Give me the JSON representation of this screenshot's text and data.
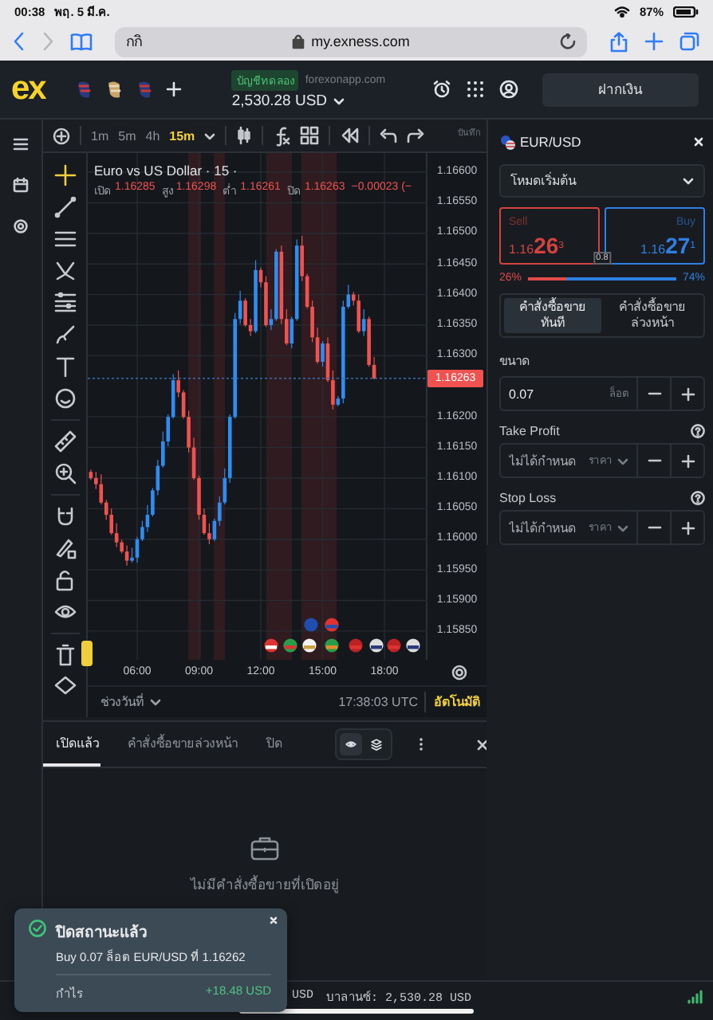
{
  "status_bar": {
    "time": "00:38",
    "date": "พฤ. 5 มี.ค.",
    "battery": "87%"
  },
  "browser": {
    "tab_hint": "กกิ",
    "url": "my.exness.com"
  },
  "header": {
    "logo": "ex",
    "account_badge": "บัญชีทดลอง",
    "account_server": "forexonapp.com",
    "balance": "2,530.28 USD",
    "deposit_button": "ฝากเงิน"
  },
  "toolbar": {
    "timeframes": [
      {
        "label": "1m",
        "selected": false
      },
      {
        "label": "5m",
        "selected": false
      },
      {
        "label": "4h",
        "selected": false
      },
      {
        "label": "15m",
        "selected": true
      }
    ],
    "save_label": "บันทึก"
  },
  "chart": {
    "title": "Euro vs US Dollar · 15 ·",
    "ohlc": [
      {
        "label": "เปิด",
        "value": "1.16285"
      },
      {
        "label": "สูง",
        "value": "1.16298"
      },
      {
        "label": "ต่ำ",
        "value": "1.16261"
      },
      {
        "label": "ปิด",
        "value": "1.16263"
      }
    ],
    "change": "−0.00023 (−",
    "chart_data": {
      "type": "candlestick",
      "x": [
        3.75,
        4,
        4.25,
        4.5,
        4.75,
        5,
        5.25,
        5.5,
        5.75,
        6,
        6.25,
        6.5,
        6.75,
        7,
        7.25,
        7.5,
        7.75,
        8,
        8.25,
        8.5,
        8.75,
        9,
        9.25,
        9.5,
        9.75,
        10,
        10.25,
        10.5,
        10.75,
        11,
        11.25,
        11.5,
        11.75,
        12,
        12.25,
        12.5,
        12.75,
        13,
        13.25,
        13.5,
        13.75,
        14,
        14.25,
        14.5,
        14.75,
        15,
        15.25,
        15.5,
        15.75,
        16,
        16.25,
        16.5,
        16.75,
        17,
        17.25,
        17.5
      ],
      "ohlc": [
        [
          1.1611,
          1.16114,
          1.16097,
          1.161
        ],
        [
          1.161,
          1.1611,
          1.16082,
          1.1609
        ],
        [
          1.1609,
          1.16106,
          1.16057,
          1.1606
        ],
        [
          1.1606,
          1.16064,
          1.16032,
          1.1604
        ],
        [
          1.1604,
          1.1605,
          1.16007,
          1.1601
        ],
        [
          1.1601,
          1.16026,
          1.15987,
          1.15995
        ],
        [
          1.15995,
          1.15999,
          1.15977,
          1.1598
        ],
        [
          1.1598,
          1.1599,
          1.15957,
          1.15965
        ],
        [
          1.15965,
          1.15986,
          1.15962,
          1.1597
        ],
        [
          1.1597,
          1.16004,
          1.15962,
          1.16
        ],
        [
          1.16,
          1.1603,
          1.15997,
          1.1602
        ],
        [
          1.1602,
          1.16056,
          1.16012,
          1.1604
        ],
        [
          1.1604,
          1.16084,
          1.16037,
          1.1608
        ],
        [
          1.1608,
          1.1613,
          1.16072,
          1.1612
        ],
        [
          1.1612,
          1.16176,
          1.16117,
          1.1616
        ],
        [
          1.1616,
          1.16204,
          1.16152,
          1.162
        ],
        [
          1.162,
          1.1627,
          1.16197,
          1.1626
        ],
        [
          1.1626,
          1.16276,
          1.16232,
          1.1624
        ],
        [
          1.1624,
          1.16244,
          1.16197,
          1.162
        ],
        [
          1.162,
          1.1621,
          1.16142,
          1.1615
        ],
        [
          1.1615,
          1.16166,
          1.16097,
          1.161
        ],
        [
          1.161,
          1.16104,
          1.16032,
          1.1604
        ],
        [
          1.1604,
          1.1605,
          1.16007,
          1.1601
        ],
        [
          1.1601,
          1.16026,
          1.15992,
          1.16
        ],
        [
          1.16,
          1.16034,
          1.15997,
          1.1603
        ],
        [
          1.1603,
          1.1607,
          1.16022,
          1.1606
        ],
        [
          1.1606,
          1.16116,
          1.16057,
          1.161
        ],
        [
          1.161,
          1.16204,
          1.16092,
          1.162
        ],
        [
          1.162,
          1.1637,
          1.16197,
          1.1636
        ],
        [
          1.1636,
          1.16406,
          1.16352,
          1.1639
        ],
        [
          1.1639,
          1.16394,
          1.16347,
          1.1635
        ],
        [
          1.1635,
          1.1636,
          1.16332,
          1.1634
        ],
        [
          1.1634,
          1.16456,
          1.16337,
          1.1644
        ],
        [
          1.1644,
          1.16444,
          1.16412,
          1.1642
        ],
        [
          1.1642,
          1.1643,
          1.16347,
          1.1635
        ],
        [
          1.1635,
          1.16376,
          1.16342,
          1.1636
        ],
        [
          1.1636,
          1.16474,
          1.16357,
          1.1647
        ],
        [
          1.1647,
          1.1648,
          1.16352,
          1.1636
        ],
        [
          1.1636,
          1.16376,
          1.16317,
          1.1632
        ],
        [
          1.1632,
          1.16364,
          1.16312,
          1.1636
        ],
        [
          1.1636,
          1.1649,
          1.16357,
          1.1648
        ],
        [
          1.1648,
          1.16496,
          1.16422,
          1.1643
        ],
        [
          1.1643,
          1.16434,
          1.16377,
          1.1638
        ],
        [
          1.1638,
          1.1639,
          1.16322,
          1.1633
        ],
        [
          1.1633,
          1.16346,
          1.16287,
          1.1629
        ],
        [
          1.1629,
          1.16324,
          1.16282,
          1.1632
        ],
        [
          1.1632,
          1.1633,
          1.16257,
          1.1626
        ],
        [
          1.1626,
          1.16276,
          1.16212,
          1.1622
        ],
        [
          1.1622,
          1.16234,
          1.16217,
          1.1623
        ],
        [
          1.1623,
          1.1639,
          1.16222,
          1.1638
        ],
        [
          1.1638,
          1.16416,
          1.16377,
          1.164
        ],
        [
          1.164,
          1.16404,
          1.16382,
          1.1639
        ],
        [
          1.1639,
          1.164,
          1.16337,
          1.1634
        ],
        [
          1.1634,
          1.16376,
          1.16332,
          1.1636
        ],
        [
          1.1636,
          1.16364,
          1.16282,
          1.16285
        ],
        [
          1.16285,
          1.16298,
          1.16261,
          1.16263
        ]
      ],
      "grid": true,
      "bands": [
        {
          "axis": "x",
          "from": 8.48,
          "to": 9.1
        },
        {
          "axis": "x",
          "from": 9.72,
          "to": 10.26
        },
        {
          "axis": "x",
          "from": 12.27,
          "to": 13.51
        },
        {
          "axis": "x",
          "from": 13.97,
          "to": 15.68
        }
      ],
      "ref_lines": [
        {
          "axis": "y",
          "value": 1.16263
        }
      ],
      "xlim": [
        3.6,
        20.09
      ],
      "ylim": [
        1.15803,
        1.166313
      ],
      "xticks": [
        {
          "value": 6,
          "label": "06:00"
        },
        {
          "value": 9,
          "label": "09:00"
        },
        {
          "value": 12,
          "label": "12:00"
        },
        {
          "value": 15,
          "label": "15:00"
        },
        {
          "value": 18,
          "label": "18:00"
        }
      ],
      "yticks": [
        {
          "value": 1.166,
          "label": "1.16600"
        },
        {
          "value": 1.1655,
          "label": "1.16550"
        },
        {
          "value": 1.165,
          "label": "1.16500"
        },
        {
          "value": 1.1645,
          "label": "1.16450"
        },
        {
          "value": 1.164,
          "label": "1.16400"
        },
        {
          "value": 1.1635,
          "label": "1.16350"
        },
        {
          "value": 1.163,
          "label": "1.16300"
        },
        {
          "value": 1.162,
          "label": "1.16200"
        },
        {
          "value": 1.1615,
          "label": "1.16150"
        },
        {
          "value": 1.161,
          "label": "1.16100"
        },
        {
          "value": 1.1605,
          "label": "1.16050"
        },
        {
          "value": 1.16,
          "label": "1.16000"
        },
        {
          "value": 1.1595,
          "label": "1.15950"
        },
        {
          "value": 1.159,
          "label": "1.15900"
        },
        {
          "value": 1.1585,
          "label": "1.15850"
        }
      ]
    },
    "current_price": "1.16263",
    "date_range": "ช่วงวันที่",
    "clock": "17:38:03 UTC",
    "auto_scale": "อัตโนมัติ"
  },
  "trade_panel": {
    "symbol": "EUR/USD",
    "mode": "โหมดเริ่มต้น",
    "sell": {
      "label": "Sell",
      "price": "1.16**26**$^{3}$"
    },
    "buy": {
      "label": "Buy",
      "price": "1.16**27**$^{1}$"
    },
    "spread": "0.8",
    "sentiment": {
      "sell": "26%",
      "buy": "74%",
      "level": 0.26
    },
    "order_tabs": [
      {
        "label": "คำสั่งซื้อขาย ทันที",
        "selected": true
      },
      {
        "label": "คำสั่งซื้อขาย ล่วงหน้า",
        "selected": false
      }
    ],
    "size": {
      "label": "ขนาด",
      "value": "0.07",
      "unit": "ล็อต"
    },
    "take_profit": {
      "label": "Take Profit",
      "placeholder": "ไม่ได้กำหนด",
      "unit": "ราคา"
    },
    "stop_loss": {
      "label": "Stop Loss",
      "placeholder": "ไม่ได้กำหนด",
      "unit": "ราคา"
    }
  },
  "orders_panel": {
    "tabs": [
      {
        "label": "เปิดแล้ว",
        "selected": true
      },
      {
        "label": "คำสั่งซื้อขายล่วงหน้า",
        "selected": false
      },
      {
        "label": "ปิด",
        "selected": false
      }
    ],
    "view_modes": [
      {
        "kind": "eye",
        "selected": true
      },
      {
        "kind": "layers",
        "selected": false
      }
    ],
    "empty_message": "ไม่มีคำสั่งซื้อขายที่เปิดอยู่"
  },
  "toast": {
    "title": "ปิดสถานะแล้ว",
    "message": "Buy 0.07 ล็อต EUR/USD ที่ 1.16262",
    "profit_label": "กำไร",
    "profit": "+18.48 USD"
  },
  "footer": {
    "partial": "USD",
    "balance": "บาลานซ์: 2,530.28 USD"
  }
}
